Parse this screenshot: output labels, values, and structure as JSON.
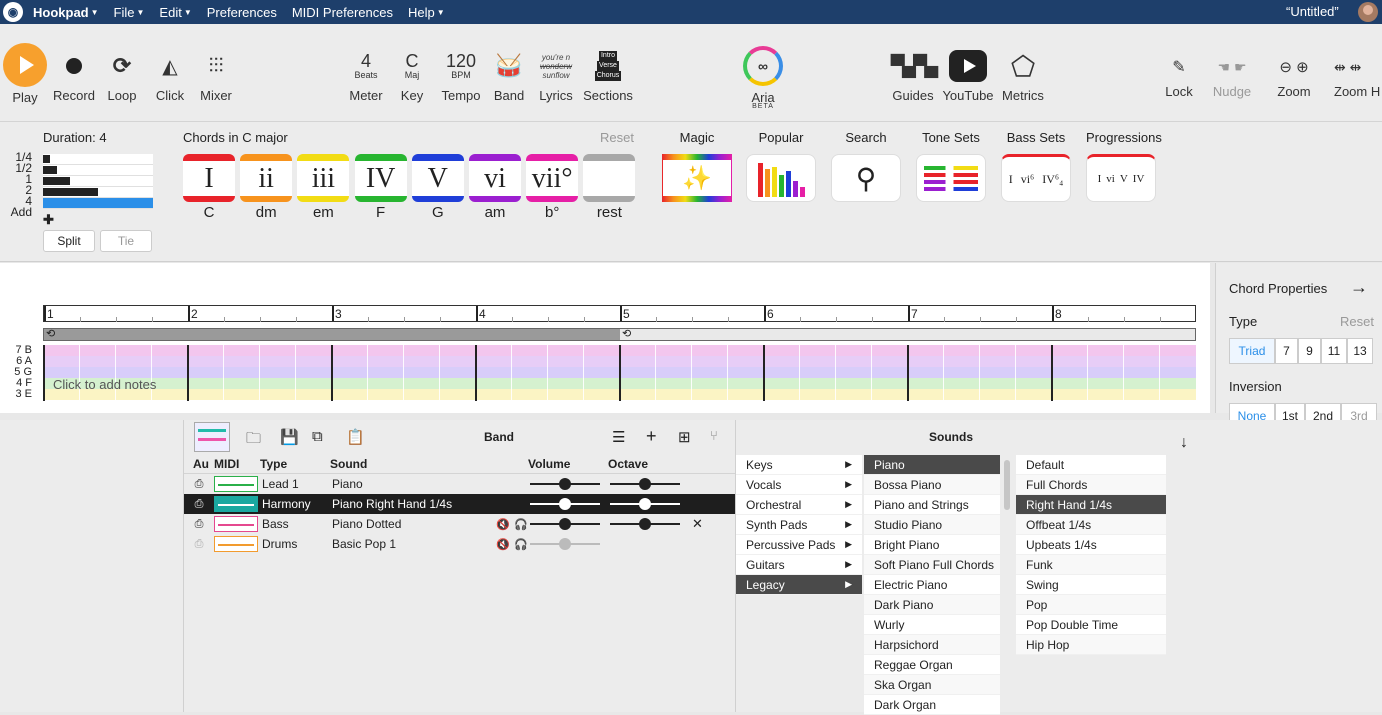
{
  "menubar": {
    "app": "Hookpad",
    "file": "File",
    "edit": "Edit",
    "preferences": "Preferences",
    "midi_preferences": "MIDI Preferences",
    "help": "Help",
    "doc_title": "“Untitled”"
  },
  "toolbar": {
    "play": "Play",
    "record": "Record",
    "loop": "Loop",
    "click": "Click",
    "mixer": "Mixer",
    "meter_value": "4",
    "meter_sub": "Beats",
    "meter": "Meter",
    "key_value": "C",
    "key_sub": "Maj",
    "key": "Key",
    "tempo_value": "120",
    "tempo_sub": "BPM",
    "tempo": "Tempo",
    "band": "Band",
    "lyrics_l1": "you're n",
    "lyrics_l2": "wonderw",
    "lyrics_l3": "sunflow",
    "lyrics": "Lyrics",
    "sections_l1": "Intro",
    "sections_l2": "Verse",
    "sections_l3": "Chorus",
    "sections": "Sections",
    "aria": "Aria",
    "aria_beta": "BETA",
    "guides": "Guides",
    "youtube": "YouTube",
    "metrics": "Metrics",
    "lock": "Lock",
    "nudge": "Nudge",
    "zoom": "Zoom",
    "zoom_h": "Zoom H"
  },
  "duration": {
    "label": "Duration: 4",
    "values": [
      "1/4",
      "1/2",
      "1",
      "2",
      "4",
      "Add"
    ],
    "split": "Split",
    "tie": "Tie"
  },
  "chords": {
    "header": "Chords in C major",
    "reset": "Reset",
    "items": [
      {
        "numeral": "I",
        "name": "C",
        "color": "#e8232a"
      },
      {
        "numeral": "ii",
        "name": "dm",
        "color": "#f7931d"
      },
      {
        "numeral": "iii",
        "name": "em",
        "color": "#f2dc14"
      },
      {
        "numeral": "IV",
        "name": "F",
        "color": "#27b530"
      },
      {
        "numeral": "V",
        "name": "G",
        "color": "#1f3ed8"
      },
      {
        "numeral": "vi",
        "name": "am",
        "color": "#9b1fd0"
      },
      {
        "numeral": "vii°",
        "name": "b°",
        "color": "#e61fa6"
      },
      {
        "numeral": "",
        "name": "rest",
        "color": "#a8a8a8"
      }
    ]
  },
  "tools": {
    "magic": "Magic",
    "popular": "Popular",
    "search": "Search",
    "tone_sets": "Tone Sets",
    "bass_sets": "Bass Sets",
    "progressions": "Progressions"
  },
  "grid": {
    "measures": [
      "1",
      "2",
      "3",
      "4",
      "5",
      "6",
      "7",
      "8"
    ],
    "rows": [
      "7 B",
      "6 A",
      "5 G",
      "4 F",
      "3 E"
    ],
    "hint": "Click to add notes"
  },
  "chord_props": {
    "title": "Chord Properties",
    "type": "Type",
    "reset": "Reset",
    "types": [
      "Triad",
      "7",
      "9",
      "11",
      "13"
    ],
    "inversion": "Inversion",
    "inversions": [
      "None",
      "1st",
      "2nd",
      "3rd"
    ]
  },
  "band": {
    "title": "Band",
    "columns": {
      "au": "Au",
      "midi": "MIDI",
      "type": "Type",
      "sound": "Sound",
      "volume": "Volume",
      "octave": "Octave"
    },
    "tracks": [
      {
        "type": "Lead 1",
        "sound": "Piano",
        "volume": 0.5,
        "octave": 0.5
      },
      {
        "type": "Harmony",
        "sound": "Piano Right Hand 1/4s",
        "volume": 0.5,
        "octave": 0.5
      },
      {
        "type": "Bass",
        "sound": "Piano Dotted",
        "volume": 0.5,
        "octave": 0.5
      },
      {
        "type": "Drums",
        "sound": "Basic Pop 1",
        "volume": 0.5
      }
    ]
  },
  "sounds": {
    "title": "Sounds",
    "categories": [
      "Keys",
      "Vocals",
      "Orchestral",
      "Synth Pads",
      "Percussive Pads",
      "Guitars",
      "Legacy"
    ],
    "instruments": [
      "Piano",
      "Bossa Piano",
      "Piano and Strings",
      "Studio Piano",
      "Bright Piano",
      "Soft Piano Full Chords",
      "Electric Piano",
      "Dark Piano",
      "Wurly",
      "Harpsichord",
      "Reggae Organ",
      "Ska Organ",
      "Dark Organ"
    ],
    "patterns": [
      "Default",
      "Full Chords",
      "Right Hand 1/4s",
      "Offbeat 1/4s",
      "Upbeats 1/4s",
      "Funk",
      "Swing",
      "Pop",
      "Pop Double Time",
      "Hip Hop"
    ]
  }
}
